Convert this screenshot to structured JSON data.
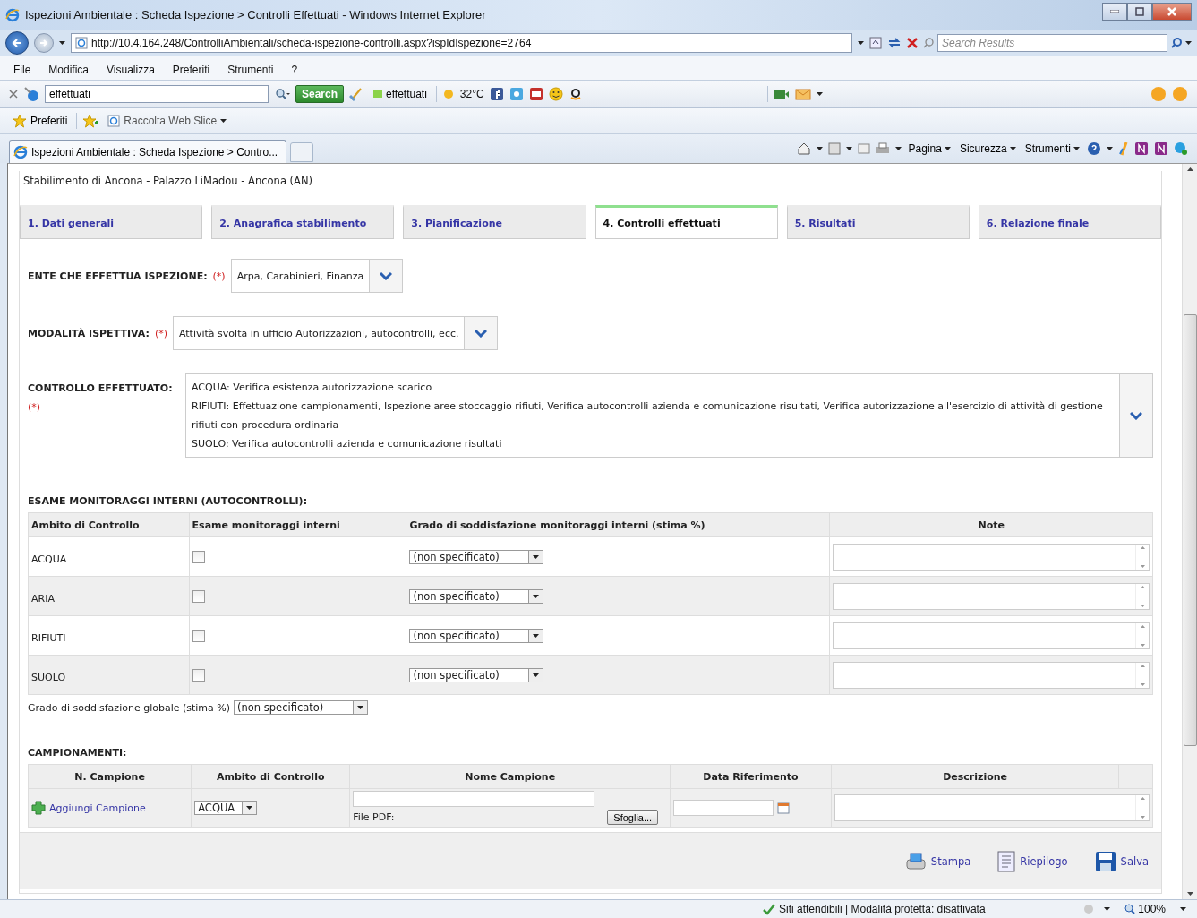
{
  "window": {
    "title": "Ispezioni Ambientale : Scheda Ispezione > Controlli Effettuati - Windows Internet Explorer"
  },
  "address_bar": {
    "url": "http://10.4.164.248/ControlliAmbientali/scheda-ispezione-controlli.aspx?ispIdIspezione=2764",
    "search_placeholder": "Search Results"
  },
  "menu": [
    "File",
    "Modifica",
    "Visualizza",
    "Preferiti",
    "Strumenti",
    "?"
  ],
  "toolbar": {
    "search_value": "effettuati",
    "search_button": "Search",
    "highlight": "effettuati",
    "temperature": "32°C"
  },
  "favorites_bar": {
    "favorites": "Preferiti",
    "web_slice": "Raccolta Web Slice"
  },
  "browser_tab": {
    "title": "Ispezioni Ambientale : Scheda Ispezione > Contro..."
  },
  "command_bar": [
    "Pagina",
    "Sicurezza",
    "Strumenti"
  ],
  "page": {
    "subtitle": "Stabilimento di Ancona - Palazzo LiMadou - Ancona (AN)",
    "tabs": [
      {
        "label": "1. Dati generali",
        "selected": false
      },
      {
        "label": "2. Anagrafica stabilimento",
        "selected": false
      },
      {
        "label": "3. Pianificazione",
        "selected": false
      },
      {
        "label": "4. Controlli effettuati",
        "selected": true
      },
      {
        "label": "5. Risultati",
        "selected": false
      },
      {
        "label": "6. Relazione finale",
        "selected": false
      }
    ],
    "ente": {
      "label": "ENTE CHE EFFETTUA ISPEZIONE:",
      "required": "(*)",
      "value": "Arpa, Carabinieri, Finanza"
    },
    "modalita": {
      "label": "MODALITÀ ISPETTIVA:",
      "required": "(*)",
      "value": "Attività svolta in ufficio Autorizzazioni, autocontrolli, ecc."
    },
    "controllo": {
      "label": "CONTROLLO EFFETTUATO:",
      "required": "(*)",
      "lines": [
        "ACQUA: Verifica esistenza autorizzazione scarico",
        "RIFIUTI: Effettuazione campionamenti, Ispezione aree stoccaggio rifiuti, Verifica autocontrolli azienda e comunicazione risultati, Verifica autorizzazione all'esercizio di attività di gestione rifiuti con procedura ordinaria",
        "SUOLO: Verifica autocontrolli azienda e comunicazione risultati"
      ]
    },
    "monitoraggi": {
      "title": "ESAME MONITORAGGI INTERNI (AUTOCONTROLLI):",
      "columns": [
        "Ambito di Controllo",
        "Esame monitoraggi interni",
        "Grado di soddisfazione monitoraggi interni (stima %)",
        "Note"
      ],
      "rows": [
        {
          "ambito": "ACQUA",
          "checked": false,
          "grado": "(non specificato)"
        },
        {
          "ambito": "ARIA",
          "checked": false,
          "grado": "(non specificato)"
        },
        {
          "ambito": "RIFIUTI",
          "checked": false,
          "grado": "(non specificato)"
        },
        {
          "ambito": "SUOLO",
          "checked": false,
          "grado": "(non specificato)"
        }
      ]
    },
    "globale": {
      "label": "Grado di soddisfazione globale (stima %)",
      "value": "(non specificato)"
    },
    "campionamenti": {
      "title": "CAMPIONAMENTI:",
      "columns": [
        "N. Campione",
        "Ambito di Controllo",
        "Nome Campione",
        "Data Riferimento",
        "Descrizione"
      ],
      "add_link": "Aggiungi Campione",
      "ambito": "ACQUA",
      "file_label": "File PDF:",
      "browse": "Sfoglia..."
    },
    "actions": [
      "Stampa",
      "Riepilogo",
      "Salva"
    ]
  },
  "status_bar": {
    "text": "Siti attendibili | Modalità protetta: disattivata",
    "zoom": "100%"
  }
}
